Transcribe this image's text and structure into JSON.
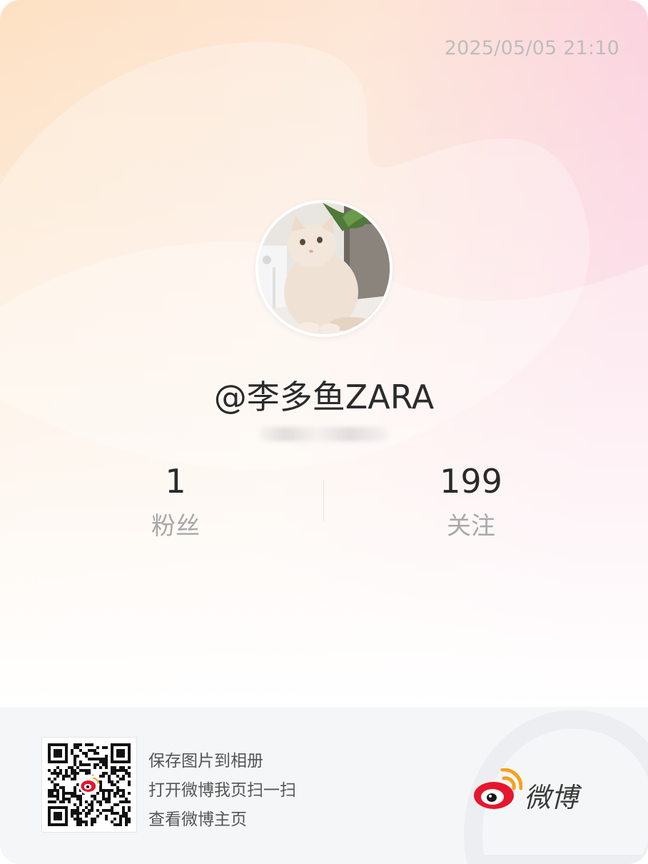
{
  "header": {
    "timestamp": "2025/05/05 21:10"
  },
  "profile": {
    "avatar": "cream-kitten-photo",
    "username": "@李多鱼ZARA"
  },
  "stats": {
    "fans": {
      "value": "1",
      "label": "粉丝"
    },
    "following": {
      "value": "199",
      "label": "关注"
    }
  },
  "footer": {
    "qr": "qr-code-with-weibo-logo",
    "lines": [
      "保存图片到相册",
      "打开微博我页扫一扫",
      "查看微博主页"
    ],
    "brand": {
      "logo": "weibo-eye-logo",
      "name": "微博"
    }
  },
  "colors": {
    "background_warm": "#fde3c8",
    "background_pink": "#fbd0df",
    "weibo_red": "#e6162d",
    "weibo_orange": "#f7a11a",
    "footer_bg": "#f5f6f8"
  }
}
